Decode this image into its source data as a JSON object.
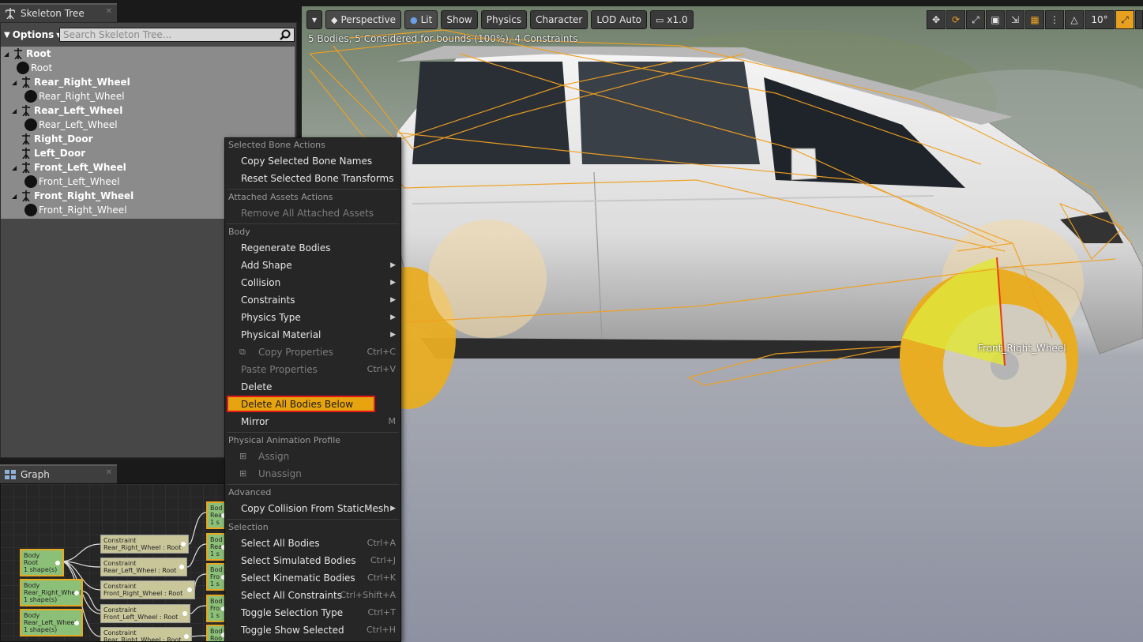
{
  "skeleton_tree": {
    "tab_title": "Skeleton Tree",
    "options_label": "Options",
    "search_placeholder": "Search Skeleton Tree...",
    "rows": [
      {
        "type": "bone",
        "label": "Root",
        "level": 0,
        "expandable": true
      },
      {
        "type": "body",
        "label": "Root",
        "level": 1
      },
      {
        "type": "bone",
        "label": "Rear_Right_Wheel",
        "level": 1,
        "expandable": true
      },
      {
        "type": "body",
        "label": "Rear_Right_Wheel",
        "level": 2
      },
      {
        "type": "bone",
        "label": "Rear_Left_Wheel",
        "level": 1,
        "expandable": true
      },
      {
        "type": "body",
        "label": "Rear_Left_Wheel",
        "level": 2
      },
      {
        "type": "bone",
        "label": "Right_Door",
        "level": 1,
        "expandable": false
      },
      {
        "type": "bone",
        "label": "Left_Door",
        "level": 1,
        "expandable": false
      },
      {
        "type": "bone",
        "label": "Front_Left_Wheel",
        "level": 1,
        "expandable": true
      },
      {
        "type": "body",
        "label": "Front_Left_Wheel",
        "level": 2
      },
      {
        "type": "bone",
        "label": "Front_Right_Wheel",
        "level": 1,
        "expandable": true
      },
      {
        "type": "body",
        "label": "Front_Right_Wheel",
        "level": 2
      }
    ]
  },
  "graph": {
    "tab_title": "Graph",
    "body_nodes": [
      {
        "line1": "Body",
        "line2": "Root",
        "line3": "1 shape(s)"
      },
      {
        "line1": "Body",
        "line2": "Rear_Right_Wheel",
        "line3": "1 shape(s)"
      },
      {
        "line1": "Body",
        "line2": "Rear_Left_Wheel",
        "line3": "1 shape(s)"
      }
    ],
    "constraint_nodes": [
      {
        "line1": "Constraint",
        "line2": "Rear_Right_Wheel : Root"
      },
      {
        "line1": "Constraint",
        "line2": "Rear_Left_Wheel : Root"
      },
      {
        "line1": "Constraint",
        "line2": "Front_Right_Wheel : Root"
      },
      {
        "line1": "Constraint",
        "line2": "Front_Left_Wheel : Root"
      },
      {
        "line1": "Constraint",
        "line2": "Rear_Right_Wheel : Root"
      }
    ],
    "right_nodes": [
      {
        "line1": "Bod",
        "line2": "Rea",
        "line3": "1 s"
      },
      {
        "line1": "Bod",
        "line2": "Rea",
        "line3": "1 s"
      },
      {
        "line1": "Bod",
        "line2": "Fro",
        "line3": "1 s"
      },
      {
        "line1": "Bod",
        "line2": "Fro",
        "line3": "1 s"
      },
      {
        "line1": "Bod",
        "line2": "Roo",
        "line3": ""
      }
    ]
  },
  "viewport": {
    "toolbar": {
      "perspective": "Perspective",
      "lit": "Lit",
      "show": "Show",
      "physics": "Physics",
      "character": "Character",
      "lod": "LOD Auto",
      "speed": "x1.0"
    },
    "right_tools": {
      "angle": "10°",
      "grid_icon": "grid-icon",
      "angle_icon": "angle-icon"
    },
    "stats": "5 Bodies, 5 Considered for bounds (100%), 4 Constraints",
    "selected_label": "Front_Right_Wheel"
  },
  "context_menu": {
    "sections": [
      {
        "title": "Selected Bone Actions",
        "items": [
          {
            "label": "Copy Selected Bone Names"
          },
          {
            "label": "Reset Selected Bone Transforms"
          }
        ]
      },
      {
        "title": "Attached Assets Actions",
        "items": [
          {
            "label": "Remove All Attached Assets",
            "disabled": true
          }
        ]
      },
      {
        "title": "Body",
        "items": [
          {
            "label": "Regenerate Bodies"
          },
          {
            "label": "Add Shape",
            "submenu": true
          },
          {
            "label": "Collision",
            "submenu": true
          },
          {
            "label": "Constraints",
            "submenu": true
          },
          {
            "label": "Physics Type",
            "submenu": true
          },
          {
            "label": "Physical Material",
            "submenu": true
          },
          {
            "label": "Copy Properties",
            "shortcut": "Ctrl+C",
            "disabled": true,
            "icon": "copy-icon"
          },
          {
            "label": "Paste Properties",
            "shortcut": "Ctrl+V",
            "disabled": true
          },
          {
            "label": "Delete"
          },
          {
            "label": "Delete All Bodies Below",
            "active": true
          },
          {
            "label": "Mirror",
            "shortcut": "M"
          }
        ]
      },
      {
        "title": "Physical Animation Profile",
        "items": [
          {
            "label": "Assign",
            "disabled": true,
            "icon": "assign-icon"
          },
          {
            "label": "Unassign",
            "disabled": true,
            "icon": "unassign-icon"
          }
        ]
      },
      {
        "title": "Advanced",
        "items": [
          {
            "label": "Copy Collision From StaticMesh",
            "submenu": true
          }
        ]
      },
      {
        "title": "Selection",
        "items": [
          {
            "label": "Select All Bodies",
            "shortcut": "Ctrl+A"
          },
          {
            "label": "Select Simulated Bodies",
            "shortcut": "Ctrl+J"
          },
          {
            "label": "Select Kinematic Bodies",
            "shortcut": "Ctrl+K"
          },
          {
            "label": "Select All Constraints",
            "shortcut": "Ctrl+Shift+A"
          },
          {
            "label": "Toggle Selection Type",
            "shortcut": "Ctrl+T"
          },
          {
            "label": "Toggle Show Selected",
            "shortcut": "Ctrl+H"
          }
        ]
      }
    ]
  },
  "colors": {
    "accent_orange": "#e8a40e",
    "highlight_red": "#e11a1a",
    "menu_bg": "#262626",
    "tree_bg": "#8b8b8b"
  }
}
